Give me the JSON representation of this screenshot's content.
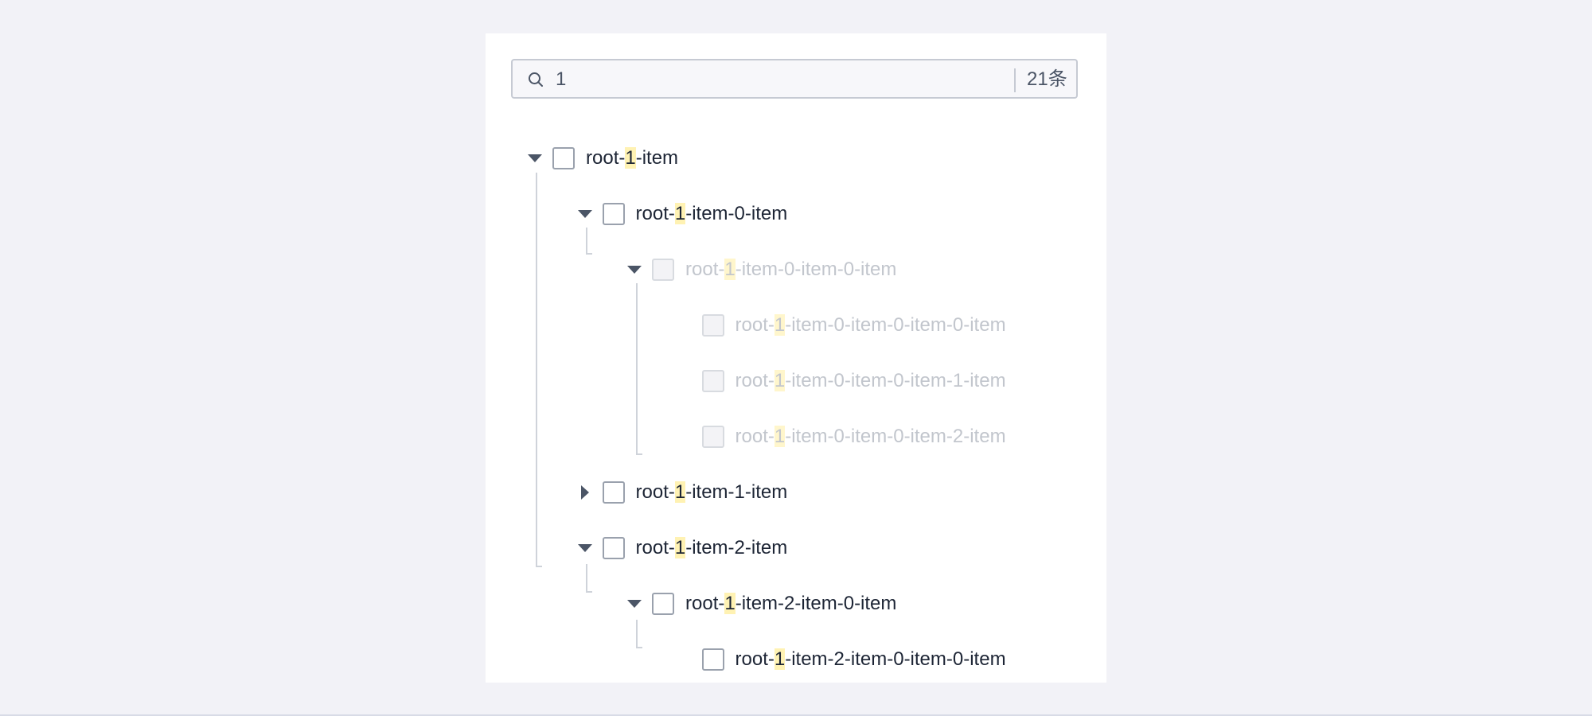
{
  "search": {
    "query": "1",
    "count": "21条"
  },
  "tree": [
    {
      "pre": "root-",
      "match": "1",
      "post": "-item",
      "expander": "expanded",
      "disabled": false
    },
    {
      "pre": "root-",
      "match": "1",
      "post": "-item-0-item",
      "expander": "expanded",
      "disabled": false
    },
    {
      "pre": "root-",
      "match": "1",
      "post": "-item-0-item-0-item",
      "expander": "expanded",
      "disabled": true
    },
    {
      "pre": "root-",
      "match": "1",
      "post": "-item-0-item-0-item-0-item",
      "expander": "none",
      "disabled": true
    },
    {
      "pre": "root-",
      "match": "1",
      "post": "-item-0-item-0-item-1-item",
      "expander": "none",
      "disabled": true
    },
    {
      "pre": "root-",
      "match": "1",
      "post": "-item-0-item-0-item-2-item",
      "expander": "none",
      "disabled": true
    },
    {
      "pre": "root-",
      "match": "1",
      "post": "-item-1-item",
      "expander": "collapsed",
      "disabled": false
    },
    {
      "pre": "root-",
      "match": "1",
      "post": "-item-2-item",
      "expander": "expanded",
      "disabled": false
    },
    {
      "pre": "root-",
      "match": "1",
      "post": "-item-2-item-0-item",
      "expander": "expanded",
      "disabled": false
    },
    {
      "pre": "root-",
      "match": "1",
      "post": "-item-2-item-0-item-0-item",
      "expander": "none",
      "disabled": false
    }
  ],
  "colors": {
    "highlight": "#fff2b3",
    "text": "#1d2535",
    "disabled_text": "#c2c6cd",
    "guide_line": "#cfd3da"
  }
}
